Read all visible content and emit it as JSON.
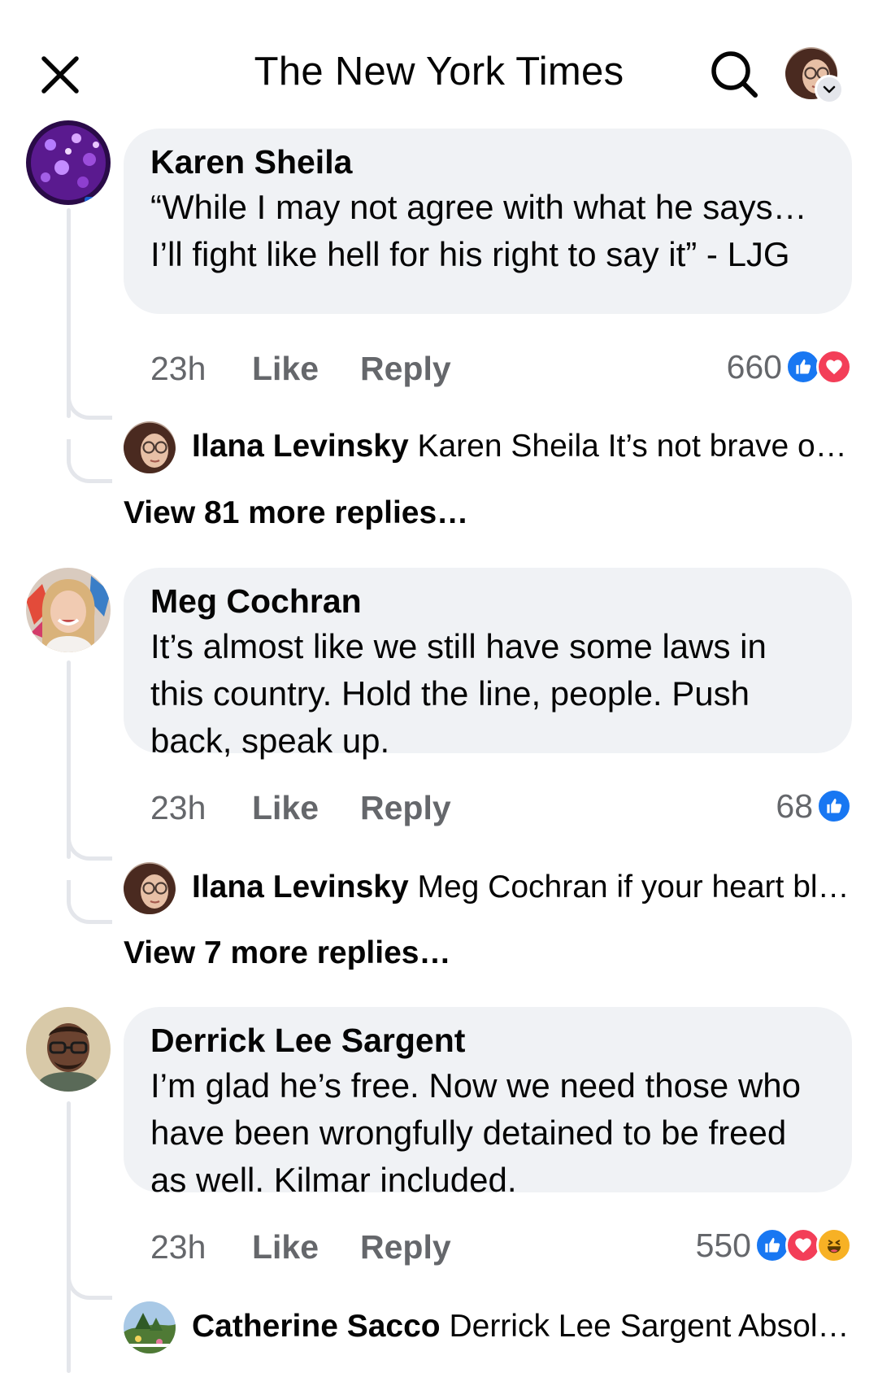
{
  "header": {
    "title": "The New York Times",
    "close_icon": "close-icon",
    "search_icon": "search-icon",
    "account_chevron_icon": "chevron-down-icon"
  },
  "comments": [
    {
      "author": "Karen Sheila",
      "text": "“While I may not agree with what he says…I’ll fight like hell for his right to say it” - LJG",
      "time": "23h",
      "like_label": "Like",
      "reply_label": "Reply",
      "reaction_count": "660",
      "reactions": [
        "like",
        "love"
      ],
      "reply_preview": {
        "author": "Ilana Levinsky",
        "text": "Karen Sheila It’s not brave or p…"
      },
      "view_more": "View 81 more replies…"
    },
    {
      "author": "Meg Cochran",
      "text": "It’s almost like we still have some laws in this country. Hold the line, people. Push back, speak up.",
      "time": "23h",
      "like_label": "Like",
      "reply_label": "Reply",
      "reaction_count": "68",
      "reactions": [
        "like"
      ],
      "reply_preview": {
        "author": "Ilana Levinsky",
        "text": "Meg Cochran if your heart ble…"
      },
      "view_more": "View 7 more replies…"
    },
    {
      "author": "Derrick Lee Sargent",
      "text": "I’m glad he’s free. Now we need those who have been wrongfully detained to be freed as well. Kilmar included.",
      "time": "23h",
      "like_label": "Like",
      "reply_label": "Reply",
      "reaction_count": "550",
      "reactions": [
        "like",
        "love",
        "haha"
      ],
      "reply_preview": {
        "author": "Catherine Sacco",
        "text": "Derrick Lee Sargent Absolut…"
      }
    }
  ],
  "colors": {
    "bubble": "#f0f2f5",
    "meta_text": "#65676b",
    "like_blue": "#1877f2",
    "love_red": "#f33e58",
    "haha_yellow": "#f7b125",
    "thread_line": "#e4e6eb"
  }
}
